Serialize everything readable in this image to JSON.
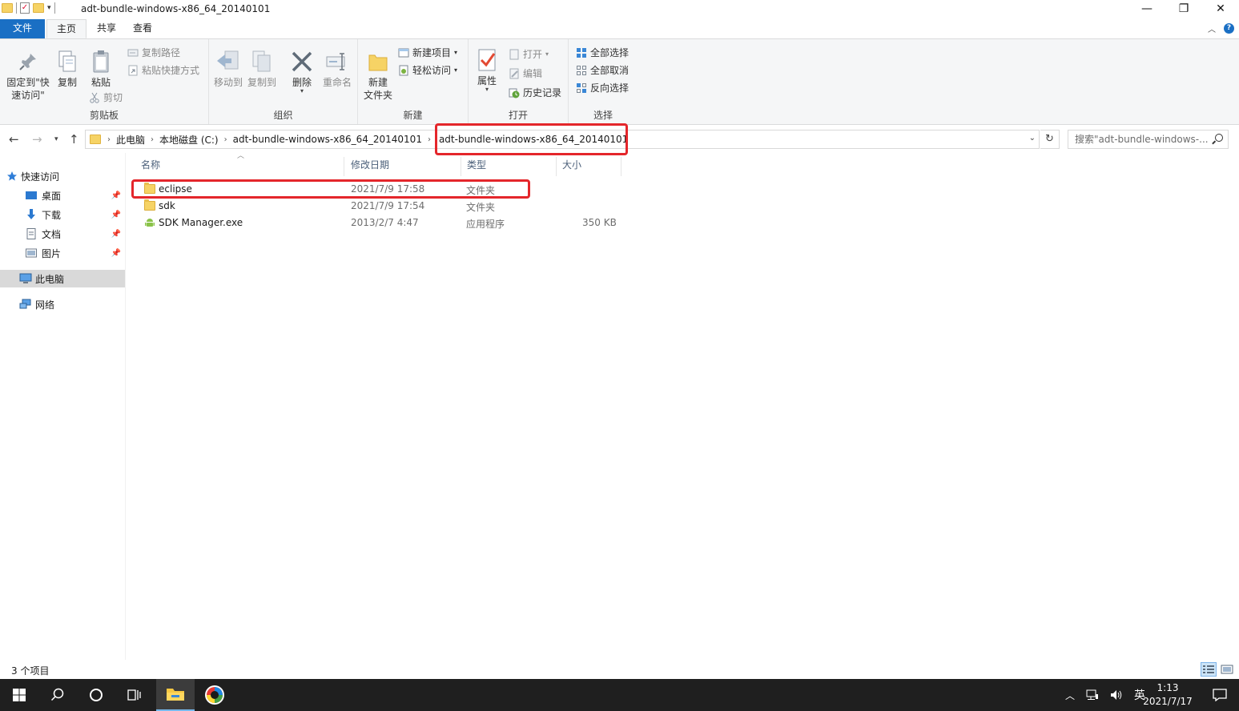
{
  "window": {
    "title": "adt-bundle-windows-x86_64_20140101",
    "controls": [
      "—",
      "❐",
      "✕"
    ]
  },
  "ribbon_tabs": [
    "文件",
    "主页",
    "共享",
    "查看"
  ],
  "ribbon": {
    "clipboard": {
      "pin_label_line1": "固定到\"快",
      "pin_label_line2": "速访问\"",
      "copy": "复制",
      "paste": "粘贴",
      "copy_path": "复制路径",
      "paste_shortcut": "粘贴快捷方式",
      "cut": "剪切",
      "group": "剪贴板"
    },
    "organize": {
      "move_to": "移动到",
      "copy_to": "复制到",
      "delete": "删除",
      "rename": "重命名",
      "group": "组织"
    },
    "new": {
      "new_folder_line1": "新建",
      "new_folder_line2": "文件夹",
      "new_item": "新建项目",
      "easy_access": "轻松访问",
      "group": "新建"
    },
    "open": {
      "properties": "属性",
      "open": "打开",
      "edit": "编辑",
      "history": "历史记录",
      "group": "打开"
    },
    "select": {
      "select_all": "全部选择",
      "select_none": "全部取消",
      "invert": "反向选择",
      "group": "选择"
    }
  },
  "address": {
    "breadcrumbs": [
      "此电脑",
      "本地磁盘 (C:)",
      "adt-bundle-windows-x86_64_20140101",
      "adt-bundle-windows-x86_64_20140101"
    ],
    "search_placeholder": "搜索\"adt-bundle-windows-..."
  },
  "nav": {
    "quick_access": "快速访问",
    "items": [
      {
        "label": "桌面",
        "icon": "desktop-icon"
      },
      {
        "label": "下载",
        "icon": "download-icon"
      },
      {
        "label": "文档",
        "icon": "document-icon"
      },
      {
        "label": "图片",
        "icon": "picture-icon"
      }
    ],
    "this_pc": "此电脑",
    "network": "网络"
  },
  "columns": [
    "名称",
    "修改日期",
    "类型",
    "大小"
  ],
  "files": [
    {
      "name": "eclipse",
      "date": "2021/7/9 17:58",
      "type": "文件夹",
      "size": "",
      "icon": "folder-icon"
    },
    {
      "name": "sdk",
      "date": "2021/7/9 17:54",
      "type": "文件夹",
      "size": "",
      "icon": "folder-icon"
    },
    {
      "name": "SDK Manager.exe",
      "date": "2013/2/7 4:47",
      "type": "应用程序",
      "size": "350 KB",
      "icon": "android-icon"
    }
  ],
  "status": {
    "count": "3 个项目"
  },
  "taskbar": {
    "ime": "英",
    "time": "1:13",
    "date": "2021/7/17"
  },
  "colors": {
    "accent": "#1a6fc4",
    "highlight_box": "#e4262b",
    "taskbar": "#1f1f1f"
  }
}
